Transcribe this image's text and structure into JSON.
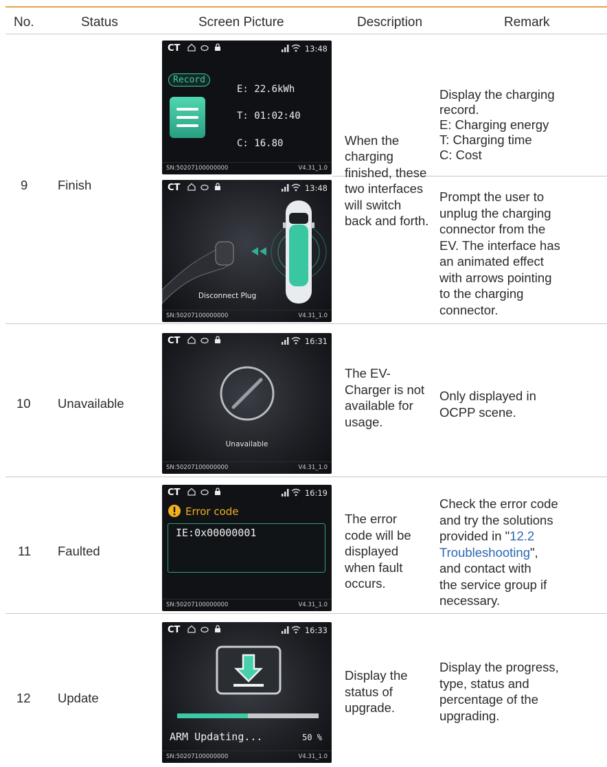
{
  "headers": {
    "no": "No.",
    "status": "Status",
    "screen": "Screen Picture",
    "description": "Description",
    "remark": "Remark"
  },
  "common": {
    "ct": "CT",
    "sn": "SN:50207100000000",
    "version": "V4.31_1.0"
  },
  "rows": [
    {
      "no": "9",
      "status": "Finish",
      "description": [
        "When the",
        "charging",
        "finished, these",
        "two interfaces",
        "will switch",
        "back and forth."
      ],
      "screens": [
        {
          "time": "13:48",
          "badge": "Record",
          "energy": "E: 22.6kWh",
          "duration": "T: 01:02:40",
          "cost": "C: 16.80"
        },
        {
          "time": "13:48",
          "caption": "Disconnect Plug"
        }
      ],
      "remarks": [
        [
          "Display the charging",
          "record.",
          "E: Charging energy",
          "T: Charging time",
          "C: Cost"
        ],
        [
          "Prompt the user to",
          "unplug the charging",
          "connector from the",
          "EV. The interface has",
          "an animated effect",
          "with arrows pointing",
          "to the charging",
          "connector."
        ]
      ]
    },
    {
      "no": "10",
      "status": "Unavailable",
      "description": [
        "The EV-",
        "Charger is not",
        "available for",
        "usage."
      ],
      "screen": {
        "time": "16:31",
        "caption": "Unavailable"
      },
      "remark": [
        "Only displayed in",
        "OCPP scene."
      ]
    },
    {
      "no": "11",
      "status": "Faulted",
      "description": [
        "The error",
        "code will be",
        "displayed",
        "when fault",
        "occurs."
      ],
      "screen": {
        "time": "16:19",
        "title": "Error code",
        "code": "IE:0x00000001"
      },
      "remark": {
        "line1": "Check the error code",
        "line2": "and try the solutions",
        "line3_pre": "provided in \"",
        "line3_link": "12.2",
        "line4_link": "Troubleshooting",
        "line4_post": "\",",
        "line5": "and contact with",
        "line6": "the service group if",
        "line7": "necessary."
      }
    },
    {
      "no": "12",
      "status": "Update",
      "description": [
        "Display the",
        "status of",
        "upgrade."
      ],
      "screen": {
        "time": "16:33",
        "progress_label": "ARM Updating...",
        "percent_text": "50 %",
        "progress": 0.5
      },
      "remark": [
        "Display the progress,",
        "type, status and",
        "percentage of the",
        "upgrading."
      ]
    }
  ],
  "colors": {
    "accent": "#e3a24a",
    "teal": "#3cc9a6",
    "link": "#2a66b3",
    "warn": "#f2b01e"
  }
}
